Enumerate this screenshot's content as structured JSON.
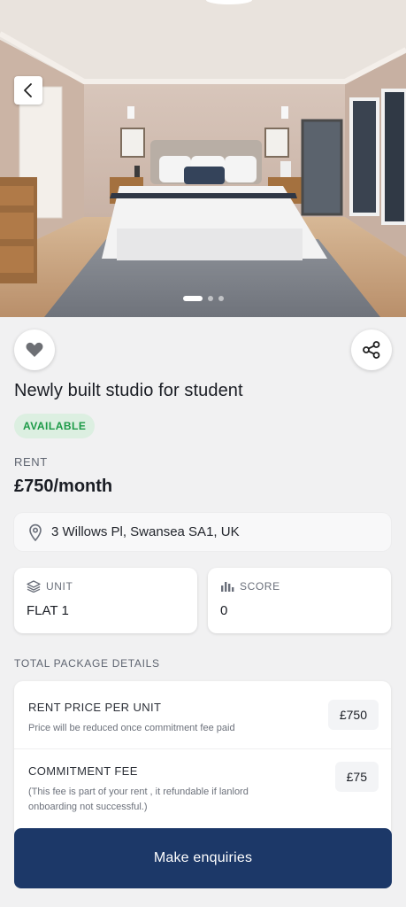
{
  "listing": {
    "title": "Newly built studio for student",
    "status": "AVAILABLE",
    "status_color": "#1c9a47",
    "rent_label": "RENT",
    "rent_value": "£750/month",
    "address": "3 Willows Pl, Swansea SA1, UK"
  },
  "gallery": {
    "total_images": 3,
    "active_index": 0
  },
  "icons": {
    "back": "chevron-left-icon",
    "favorite": "heart-icon",
    "share": "share-icon",
    "location": "location-pin-icon",
    "unit": "layers-icon",
    "score": "bar-chart-icon"
  },
  "stats": {
    "unit_label": "UNIT",
    "unit_value": "FLAT 1",
    "score_label": "SCORE",
    "score_value": "0"
  },
  "package": {
    "heading": "TOTAL PACKAGE DETAILS",
    "items": [
      {
        "title": "RENT PRICE PER UNIT",
        "description": "Price will be reduced once commitment fee paid",
        "price": "£750"
      },
      {
        "title": "COMMITMENT FEE",
        "description": "(This fee is part of your rent , it refundable if lanlord onboarding not successful.)",
        "price": "£75"
      }
    ]
  },
  "cta": {
    "label": "Make enquiries",
    "color": "#1c3868"
  }
}
